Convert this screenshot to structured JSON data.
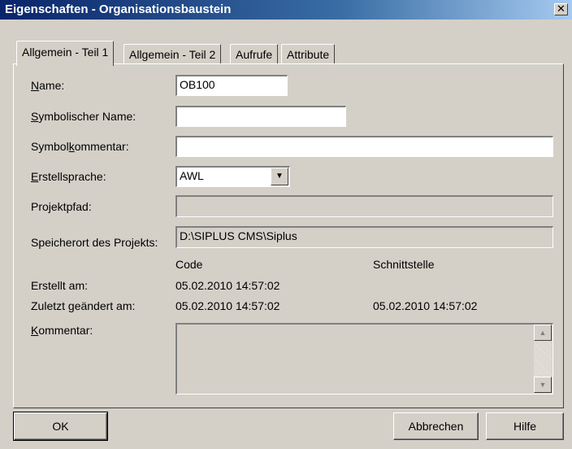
{
  "window": {
    "title": "Eigenschaften - Organisationsbaustein",
    "close_glyph": "✕"
  },
  "tabs": [
    {
      "label": "Allgemein - Teil 1",
      "active": true
    },
    {
      "label": "Allgemein - Teil 2",
      "active": false
    },
    {
      "label": "Aufrufe",
      "active": false
    },
    {
      "label": "Attribute",
      "active": false
    }
  ],
  "form": {
    "name": {
      "label": "Name:",
      "value": "OB100"
    },
    "symbolic_name": {
      "label": "Symbolischer Name:",
      "value": ""
    },
    "symbol_comment": {
      "label": "Symbolkommentar:",
      "value": ""
    },
    "language": {
      "label": "Erstellsprache:",
      "value": "AWL"
    },
    "project_path": {
      "label": "Projektpfad:",
      "value": ""
    },
    "storage_location": {
      "label": "Speicherort des Projekts:",
      "value": "D:\\SIPLUS CMS\\Siplus"
    },
    "col_code": "Code",
    "col_interface": "Schnittstelle",
    "created": {
      "label": "Erstellt am:",
      "code": "05.02.2010 14:57:02",
      "interface": ""
    },
    "modified": {
      "label": "Zuletzt geändert am:",
      "code": "05.02.2010 14:57:02",
      "interface": "05.02.2010 14:57:02"
    },
    "comment": {
      "label": "Kommentar:",
      "value": ""
    }
  },
  "buttons": {
    "ok": "OK",
    "cancel": "Abbrechen",
    "help": "Hilfe"
  },
  "icons": {
    "combo_arrow": "▼",
    "scroll_up": "▲",
    "scroll_down": "▼"
  }
}
